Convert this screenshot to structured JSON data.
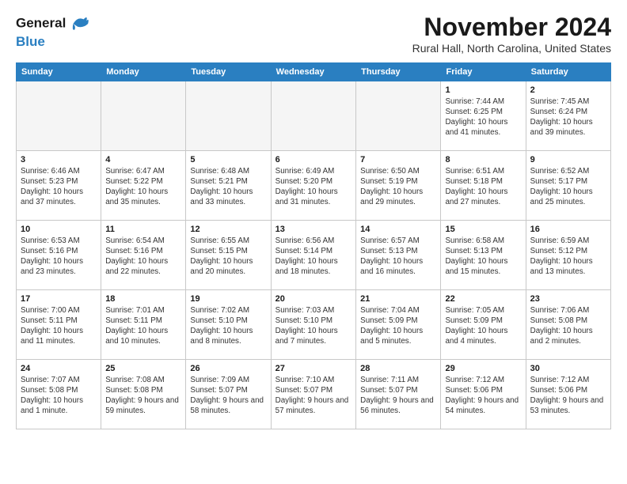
{
  "header": {
    "logo_line1": "General",
    "logo_line2": "Blue",
    "month": "November 2024",
    "location": "Rural Hall, North Carolina, United States"
  },
  "weekdays": [
    "Sunday",
    "Monday",
    "Tuesday",
    "Wednesday",
    "Thursday",
    "Friday",
    "Saturday"
  ],
  "weeks": [
    [
      {
        "day": "",
        "info": ""
      },
      {
        "day": "",
        "info": ""
      },
      {
        "day": "",
        "info": ""
      },
      {
        "day": "",
        "info": ""
      },
      {
        "day": "",
        "info": ""
      },
      {
        "day": "1",
        "info": "Sunrise: 7:44 AM\nSunset: 6:25 PM\nDaylight: 10 hours\nand 41 minutes."
      },
      {
        "day": "2",
        "info": "Sunrise: 7:45 AM\nSunset: 6:24 PM\nDaylight: 10 hours\nand 39 minutes."
      }
    ],
    [
      {
        "day": "3",
        "info": "Sunrise: 6:46 AM\nSunset: 5:23 PM\nDaylight: 10 hours\nand 37 minutes."
      },
      {
        "day": "4",
        "info": "Sunrise: 6:47 AM\nSunset: 5:22 PM\nDaylight: 10 hours\nand 35 minutes."
      },
      {
        "day": "5",
        "info": "Sunrise: 6:48 AM\nSunset: 5:21 PM\nDaylight: 10 hours\nand 33 minutes."
      },
      {
        "day": "6",
        "info": "Sunrise: 6:49 AM\nSunset: 5:20 PM\nDaylight: 10 hours\nand 31 minutes."
      },
      {
        "day": "7",
        "info": "Sunrise: 6:50 AM\nSunset: 5:19 PM\nDaylight: 10 hours\nand 29 minutes."
      },
      {
        "day": "8",
        "info": "Sunrise: 6:51 AM\nSunset: 5:18 PM\nDaylight: 10 hours\nand 27 minutes."
      },
      {
        "day": "9",
        "info": "Sunrise: 6:52 AM\nSunset: 5:17 PM\nDaylight: 10 hours\nand 25 minutes."
      }
    ],
    [
      {
        "day": "10",
        "info": "Sunrise: 6:53 AM\nSunset: 5:16 PM\nDaylight: 10 hours\nand 23 minutes."
      },
      {
        "day": "11",
        "info": "Sunrise: 6:54 AM\nSunset: 5:16 PM\nDaylight: 10 hours\nand 22 minutes."
      },
      {
        "day": "12",
        "info": "Sunrise: 6:55 AM\nSunset: 5:15 PM\nDaylight: 10 hours\nand 20 minutes."
      },
      {
        "day": "13",
        "info": "Sunrise: 6:56 AM\nSunset: 5:14 PM\nDaylight: 10 hours\nand 18 minutes."
      },
      {
        "day": "14",
        "info": "Sunrise: 6:57 AM\nSunset: 5:13 PM\nDaylight: 10 hours\nand 16 minutes."
      },
      {
        "day": "15",
        "info": "Sunrise: 6:58 AM\nSunset: 5:13 PM\nDaylight: 10 hours\nand 15 minutes."
      },
      {
        "day": "16",
        "info": "Sunrise: 6:59 AM\nSunset: 5:12 PM\nDaylight: 10 hours\nand 13 minutes."
      }
    ],
    [
      {
        "day": "17",
        "info": "Sunrise: 7:00 AM\nSunset: 5:11 PM\nDaylight: 10 hours\nand 11 minutes."
      },
      {
        "day": "18",
        "info": "Sunrise: 7:01 AM\nSunset: 5:11 PM\nDaylight: 10 hours\nand 10 minutes."
      },
      {
        "day": "19",
        "info": "Sunrise: 7:02 AM\nSunset: 5:10 PM\nDaylight: 10 hours\nand 8 minutes."
      },
      {
        "day": "20",
        "info": "Sunrise: 7:03 AM\nSunset: 5:10 PM\nDaylight: 10 hours\nand 7 minutes."
      },
      {
        "day": "21",
        "info": "Sunrise: 7:04 AM\nSunset: 5:09 PM\nDaylight: 10 hours\nand 5 minutes."
      },
      {
        "day": "22",
        "info": "Sunrise: 7:05 AM\nSunset: 5:09 PM\nDaylight: 10 hours\nand 4 minutes."
      },
      {
        "day": "23",
        "info": "Sunrise: 7:06 AM\nSunset: 5:08 PM\nDaylight: 10 hours\nand 2 minutes."
      }
    ],
    [
      {
        "day": "24",
        "info": "Sunrise: 7:07 AM\nSunset: 5:08 PM\nDaylight: 10 hours\nand 1 minute."
      },
      {
        "day": "25",
        "info": "Sunrise: 7:08 AM\nSunset: 5:08 PM\nDaylight: 9 hours\nand 59 minutes."
      },
      {
        "day": "26",
        "info": "Sunrise: 7:09 AM\nSunset: 5:07 PM\nDaylight: 9 hours\nand 58 minutes."
      },
      {
        "day": "27",
        "info": "Sunrise: 7:10 AM\nSunset: 5:07 PM\nDaylight: 9 hours\nand 57 minutes."
      },
      {
        "day": "28",
        "info": "Sunrise: 7:11 AM\nSunset: 5:07 PM\nDaylight: 9 hours\nand 56 minutes."
      },
      {
        "day": "29",
        "info": "Sunrise: 7:12 AM\nSunset: 5:06 PM\nDaylight: 9 hours\nand 54 minutes."
      },
      {
        "day": "30",
        "info": "Sunrise: 7:12 AM\nSunset: 5:06 PM\nDaylight: 9 hours\nand 53 minutes."
      }
    ]
  ]
}
